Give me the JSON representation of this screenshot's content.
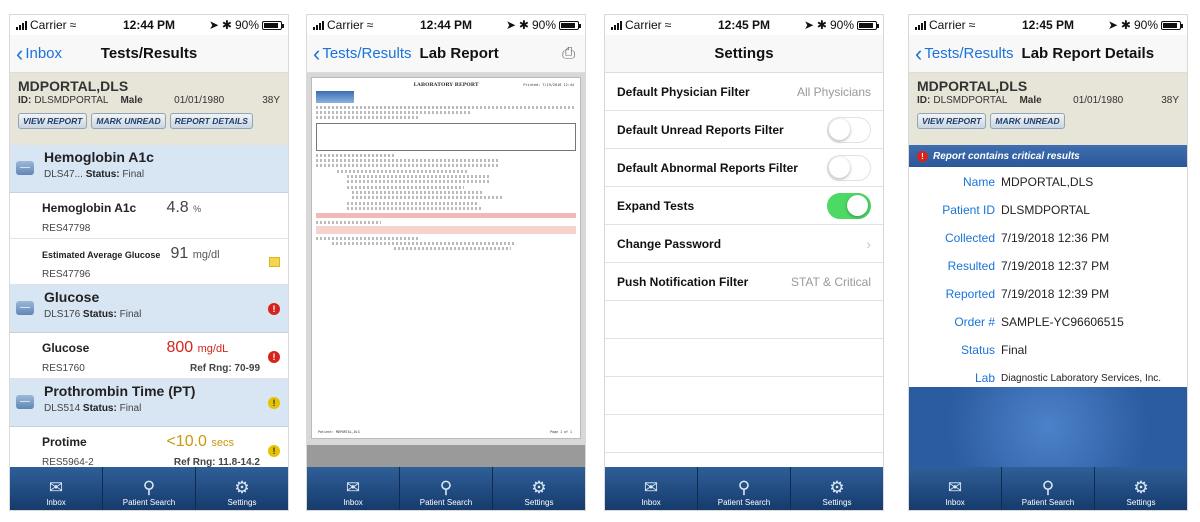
{
  "status": {
    "carrier": "Carrier",
    "battery": "90%",
    "times": [
      "12:44 PM",
      "12:44 PM",
      "12:45 PM",
      "12:45 PM"
    ]
  },
  "tabs": [
    "Inbox",
    "Patient Search",
    "Settings"
  ],
  "screen1": {
    "back": "Inbox",
    "title": "Tests/Results",
    "patient": {
      "name": "MDPORTAL,DLS",
      "id_label": "ID:",
      "id": "DLSMDPORTAL",
      "sex": "Male",
      "dob": "01/01/1980",
      "age": "38Y"
    },
    "buttons": [
      "VIEW REPORT",
      "MARK UNREAD",
      "REPORT DETAILS"
    ],
    "groups": [
      {
        "name": "Hemoglobin A1c",
        "code": "DLS47...",
        "status_label": "Status:",
        "status": "Final",
        "tests": [
          {
            "name": "Hemoglobin A1c",
            "value": "4.8",
            "unit": "%",
            "code": "RES47798",
            "ref": ""
          },
          {
            "name": "Estimated Average Glucose",
            "value": "91",
            "unit": "mg/dl",
            "code": "RES47796",
            "ref": ""
          }
        ]
      },
      {
        "name": "Glucose",
        "code": "DLS176",
        "status_label": "Status:",
        "status": "Final",
        "tests": [
          {
            "name": "Glucose",
            "value": "800",
            "unit": "mg/dL",
            "code": "RES1760",
            "ref": "Ref Rng: 70-99"
          }
        ]
      },
      {
        "name": "Prothrombin Time (PT)",
        "code": "DLS514",
        "status_label": "Status:",
        "status": "Final",
        "tests": [
          {
            "name": "Protime",
            "value": "<10.0",
            "unit": "secs",
            "code": "RES5964-2",
            "ref": "Ref Rng: 11.8-14.2"
          }
        ]
      }
    ],
    "colors": {
      "critical": "#d6241d",
      "warning": "#c9990a"
    }
  },
  "screen2": {
    "back": "Tests/Results",
    "title": "Lab Report",
    "report_title": "LABORATORY REPORT",
    "printed": "Printed: 7/19/2018 12:44",
    "footer": "Patient: MDPORTAL,DLS",
    "page": "Page 1 of 1"
  },
  "screen3": {
    "title": "Settings",
    "rows": [
      {
        "label": "Default Physician Filter",
        "value": "All Physicians",
        "kind": "value"
      },
      {
        "label": "Default Unread Reports Filter",
        "kind": "toggle",
        "on": false
      },
      {
        "label": "Default Abnormal Reports Filter",
        "kind": "toggle",
        "on": false
      },
      {
        "label": "Expand Tests",
        "kind": "toggle",
        "on": true
      },
      {
        "label": "Change Password",
        "kind": "chevron"
      },
      {
        "label": "Push Notification Filter",
        "value": "STAT & Critical",
        "kind": "value"
      }
    ]
  },
  "screen4": {
    "back": "Tests/Results",
    "title": "Lab Report Details",
    "critical_banner": "Report contains critical results",
    "details": [
      {
        "label": "Name",
        "value": "MDPORTAL,DLS"
      },
      {
        "label": "Patient ID",
        "value": "DLSMDPORTAL"
      },
      {
        "label": "Collected",
        "value": "7/19/2018 12:36 PM"
      },
      {
        "label": "Resulted",
        "value": "7/19/2018 12:37 PM"
      },
      {
        "label": "Reported",
        "value": "7/19/2018 12:39 PM"
      },
      {
        "label": "Order #",
        "value": "SAMPLE-YC96606515"
      },
      {
        "label": "Status",
        "value": "Final"
      },
      {
        "label": "Lab",
        "value": "Diagnostic Laboratory Services, Inc."
      }
    ]
  }
}
